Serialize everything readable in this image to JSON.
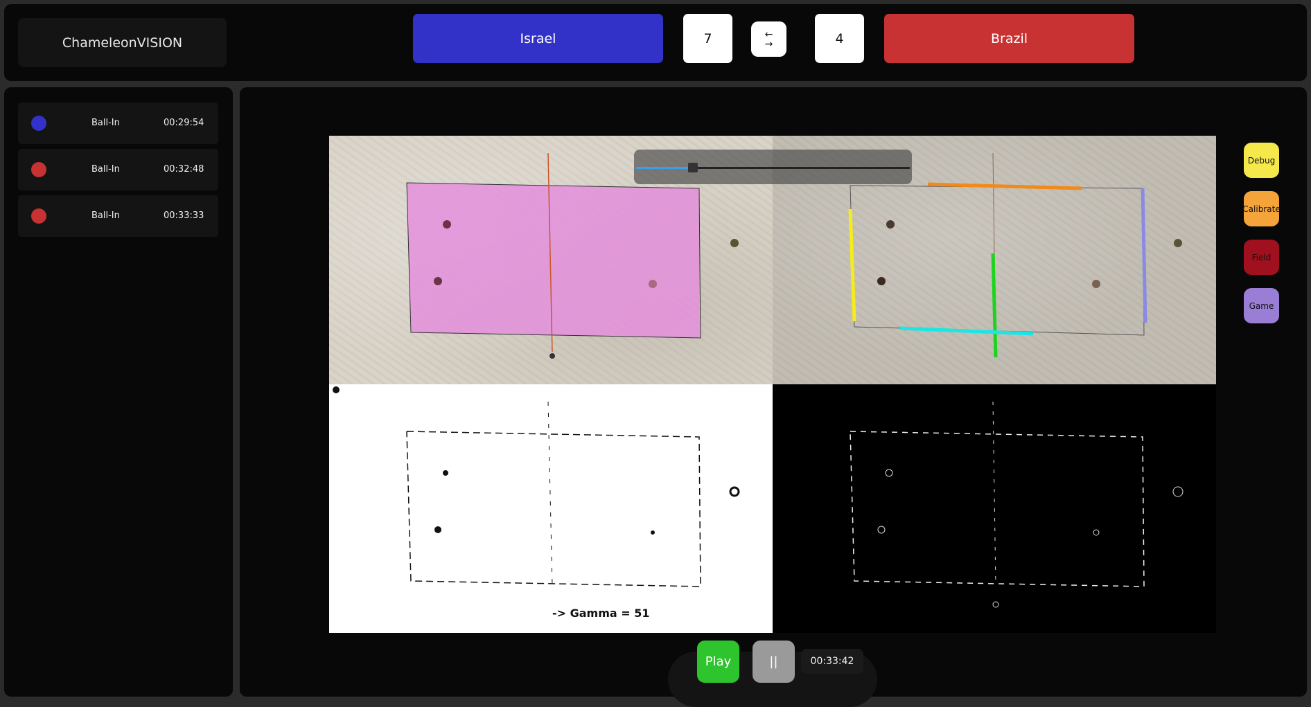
{
  "app": {
    "title": "ChameleonVISION"
  },
  "scoreboard": {
    "team_left": {
      "name": "Israel",
      "score": "7",
      "color": "#3232c8"
    },
    "team_right": {
      "name": "Brazil",
      "score": "4",
      "color": "#c83232"
    },
    "swap_icon": "swap-arrows-icon"
  },
  "events": [
    {
      "type": "Ball-In",
      "time": "00:29:54",
      "team_color": "#3232c8"
    },
    {
      "type": "Ball-In",
      "time": "00:32:48",
      "team_color": "#c83232"
    },
    {
      "type": "Ball-In",
      "time": "00:33:33",
      "team_color": "#c83232"
    }
  ],
  "video": {
    "overlay_text": "-> Gamma = 51",
    "seek_progress": 0.2
  },
  "side_buttons": [
    {
      "label": "Debug",
      "color": "#f5e84a"
    },
    {
      "label": "Calibrate",
      "color": "#f5a43a"
    },
    {
      "label": "Field",
      "color": "#a0101e"
    },
    {
      "label": "Game",
      "color": "#9a7ed6"
    }
  ],
  "controls": {
    "play_label": "Play",
    "pause_label": "||",
    "time": "00:33:42"
  }
}
